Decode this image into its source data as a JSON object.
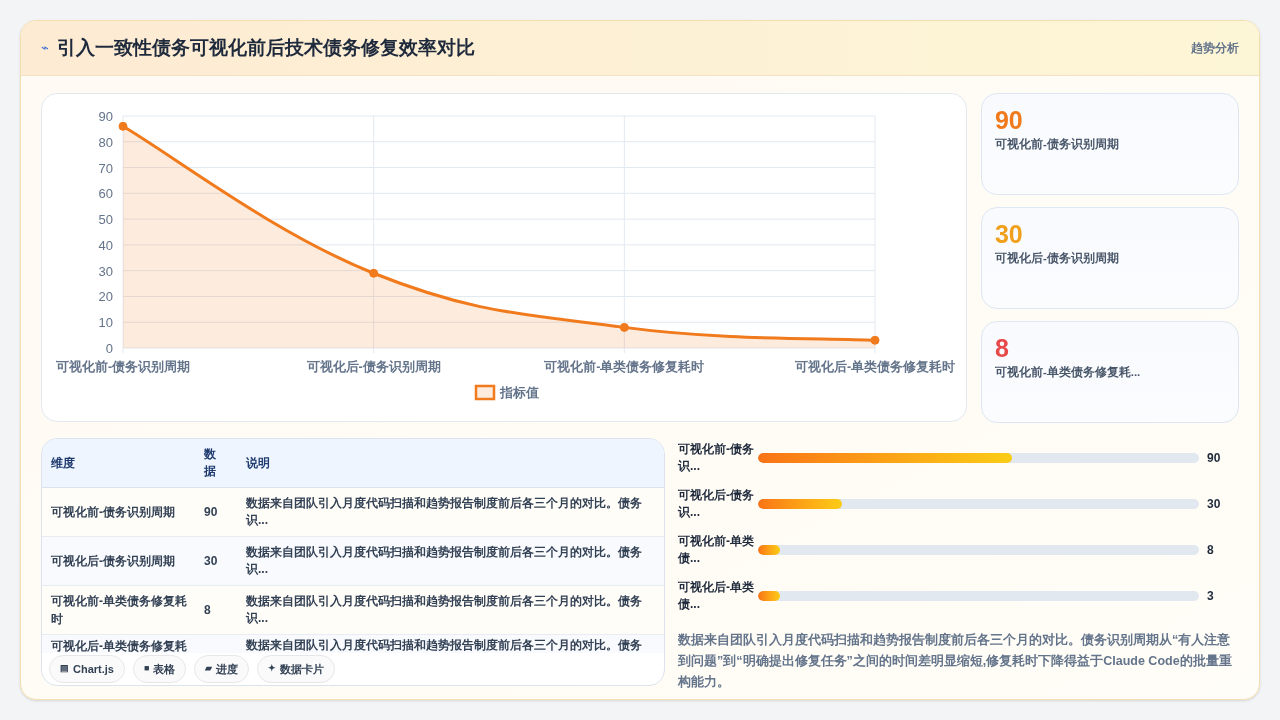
{
  "header": {
    "icon": "⌁",
    "title": "引入一致性债务可视化前后技术债务修复效率对比",
    "tag": "趋势分析"
  },
  "chart_data": {
    "type": "area",
    "categories": [
      "可视化前-债务识别周期",
      "可视化后-债务识别周期",
      "可视化前-单类债务修复耗时",
      "可视化后-单类债务修复耗时"
    ],
    "series": [
      {
        "name": "指标值",
        "color": "#f07a1c",
        "values": [
          86,
          29,
          8,
          3
        ]
      }
    ],
    "ylim": [
      0,
      90
    ],
    "grid": true,
    "yticks": [
      0,
      10,
      20,
      30,
      40,
      50,
      60,
      70,
      80,
      90
    ]
  },
  "stat_cards": [
    {
      "value": "90",
      "label": "可视化前-债务识别周期",
      "color": "#f07a1c"
    },
    {
      "value": "30",
      "label": "可视化后-债务识别周期",
      "color": "#f0a01c"
    },
    {
      "value": "8",
      "label": "可视化前-单类债务修复耗...",
      "color": "#e84848"
    }
  ],
  "table": {
    "columns": [
      "维度",
      "数据",
      "说明"
    ],
    "rows": [
      {
        "dimension": "可视化前-债务识别周期",
        "value": "90",
        "note": "数据来自团队引入月度代码扫描和趋势报告制度前后各三个月的对比。债务识..."
      },
      {
        "dimension": "可视化后-债务识别周期",
        "value": "30",
        "note": "数据来自团队引入月度代码扫描和趋势报告制度前后各三个月的对比。债务识..."
      },
      {
        "dimension": "可视化前-单类债务修复耗时",
        "value": "8",
        "note": "数据来自团队引入月度代码扫描和趋势报告制度前后各三个月的对比。债务识..."
      },
      {
        "dimension": "可视化后-单类债务修复耗",
        "note": "数据来自团队引入月度代码扫描和趋势报告制度前后各三个月的对比。债务"
      }
    ]
  },
  "chips": [
    {
      "icon": "▤",
      "label": "Chart.js"
    },
    {
      "icon": "■",
      "label": "表格"
    },
    {
      "icon": "▰",
      "label": "进度"
    },
    {
      "icon": "✦",
      "label": "数据卡片"
    }
  ],
  "progress": [
    {
      "label": "可视化前-债务识...",
      "level": 0.575,
      "reading": "90"
    },
    {
      "label": "可视化后-债务识...",
      "level": 0.19,
      "reading": "30"
    },
    {
      "label": "可视化前-单类债...",
      "level": 0.05,
      "reading": "8"
    },
    {
      "label": "可视化后-单类债...",
      "level": 0.05,
      "reading": "3"
    }
  ],
  "summary": "数据来自团队引入月度代码扫描和趋势报告制度前后各三个月的对比。债务识别周期从“有人注意到问题”到“明确提出修复任务”之间的时间差明显缩短,修复耗时下降得益于Claude Code的批量重构能力。"
}
